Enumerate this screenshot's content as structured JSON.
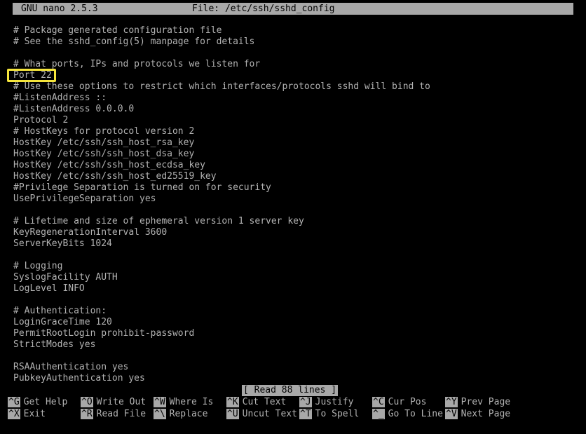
{
  "titlebar": {
    "version": "GNU nano 2.5.3",
    "file_label": "File: /etc/ssh/sshd_config"
  },
  "editor": {
    "lines": [
      "# Package generated configuration file",
      "# See the sshd_config(5) manpage for details",
      "",
      "# What ports, IPs and protocols we listen for",
      "Port 22",
      "# Use these options to restrict which interfaces/protocols sshd will bind to",
      "#ListenAddress ::",
      "#ListenAddress 0.0.0.0",
      "Protocol 2",
      "# HostKeys for protocol version 2",
      "HostKey /etc/ssh/ssh_host_rsa_key",
      "HostKey /etc/ssh/ssh_host_dsa_key",
      "HostKey /etc/ssh/ssh_host_ecdsa_key",
      "HostKey /etc/ssh/ssh_host_ed25519_key",
      "#Privilege Separation is turned on for security",
      "UsePrivilegeSeparation yes",
      "",
      "# Lifetime and size of ephemeral version 1 server key",
      "KeyRegenerationInterval 3600",
      "ServerKeyBits 1024",
      "",
      "# Logging",
      "SyslogFacility AUTH",
      "LogLevel INFO",
      "",
      "# Authentication:",
      "LoginGraceTime 120",
      "PermitRootLogin prohibit-password",
      "StrictModes yes",
      "",
      "RSAAuthentication yes",
      "PubkeyAuthentication yes"
    ]
  },
  "annotation": {
    "target_text": "Port 22",
    "color": "#f5e53c"
  },
  "status": {
    "message": "[ Read 88 lines ]"
  },
  "shortcuts": {
    "row1": [
      {
        "key": "^G",
        "label": "Get Help"
      },
      {
        "key": "^O",
        "label": "Write Out"
      },
      {
        "key": "^W",
        "label": "Where Is"
      },
      {
        "key": "^K",
        "label": "Cut Text"
      },
      {
        "key": "^J",
        "label": "Justify"
      },
      {
        "key": "^C",
        "label": "Cur Pos"
      },
      {
        "key": "^Y",
        "label": "Prev Page"
      }
    ],
    "row2": [
      {
        "key": "^X",
        "label": "Exit"
      },
      {
        "key": "^R",
        "label": "Read File"
      },
      {
        "key": "^\\",
        "label": "Replace"
      },
      {
        "key": "^U",
        "label": "Uncut Text"
      },
      {
        "key": "^T",
        "label": "To Spell"
      },
      {
        "key": "^_",
        "label": "Go To Line"
      },
      {
        "key": "^V",
        "label": "Next Page"
      }
    ]
  },
  "theme": {
    "background": "#000000",
    "foreground": "#b2b2b2",
    "inverse_background": "#a8a8a8",
    "inverse_foreground": "#000000"
  }
}
